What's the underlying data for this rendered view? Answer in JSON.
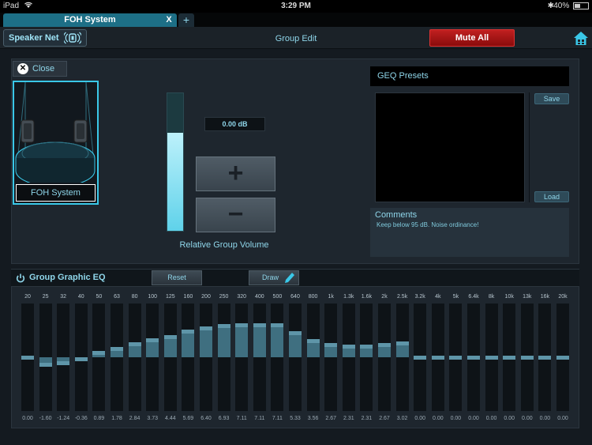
{
  "status_bar": {
    "device": "iPad",
    "time": "3:29 PM",
    "battery": "40%"
  },
  "tabs": {
    "active_label": "FOH System",
    "close_label": "X",
    "add_label": "+"
  },
  "toolbar": {
    "speaker_net_label": "Speaker Net",
    "title": "Group Edit",
    "mute_all_label": "Mute All"
  },
  "group": {
    "close_label": "Close",
    "name": "FOH System",
    "volume_value": "0.00 dB",
    "volume_level_fraction": 0.71,
    "plus_label": "+",
    "minus_label": "−",
    "volume_label": "Relative Group Volume"
  },
  "presets": {
    "title": "GEQ Presets",
    "save_label": "Save",
    "load_label": "Load",
    "comments_title": "Comments",
    "comments_text": "Keep below 95 dB. Noise ordinance!"
  },
  "eq": {
    "title": "Group Graphic EQ",
    "reset_label": "Reset",
    "draw_label": "Draw",
    "gain_range_db": 12,
    "bands": [
      {
        "freq": "20",
        "gain_label": "0.00",
        "gain": 0.0
      },
      {
        "freq": "25",
        "gain_label": "-1.60",
        "gain": -1.6
      },
      {
        "freq": "32",
        "gain_label": "-1.24",
        "gain": -1.24
      },
      {
        "freq": "40",
        "gain_label": "-0.36",
        "gain": -0.36
      },
      {
        "freq": "50",
        "gain_label": "0.89",
        "gain": 0.89
      },
      {
        "freq": "63",
        "gain_label": "1.78",
        "gain": 1.78
      },
      {
        "freq": "80",
        "gain_label": "2.84",
        "gain": 2.84
      },
      {
        "freq": "100",
        "gain_label": "3.73",
        "gain": 3.73
      },
      {
        "freq": "125",
        "gain_label": "4.44",
        "gain": 4.44
      },
      {
        "freq": "160",
        "gain_label": "5.69",
        "gain": 5.69
      },
      {
        "freq": "200",
        "gain_label": "6.40",
        "gain": 6.4
      },
      {
        "freq": "250",
        "gain_label": "6.93",
        "gain": 6.93
      },
      {
        "freq": "320",
        "gain_label": "7.11",
        "gain": 7.11
      },
      {
        "freq": "400",
        "gain_label": "7.11",
        "gain": 7.11
      },
      {
        "freq": "500",
        "gain_label": "7.11",
        "gain": 7.11
      },
      {
        "freq": "640",
        "gain_label": "5.33",
        "gain": 5.33
      },
      {
        "freq": "800",
        "gain_label": "3.56",
        "gain": 3.56
      },
      {
        "freq": "1k",
        "gain_label": "2.67",
        "gain": 2.67
      },
      {
        "freq": "1.3k",
        "gain_label": "2.31",
        "gain": 2.31
      },
      {
        "freq": "1.6k",
        "gain_label": "2.31",
        "gain": 2.31
      },
      {
        "freq": "2k",
        "gain_label": "2.67",
        "gain": 2.67
      },
      {
        "freq": "2.5k",
        "gain_label": "3.02",
        "gain": 3.02
      },
      {
        "freq": "3.2k",
        "gain_label": "0.00",
        "gain": 0.0
      },
      {
        "freq": "4k",
        "gain_label": "0.00",
        "gain": 0.0
      },
      {
        "freq": "5k",
        "gain_label": "0.00",
        "gain": 0.0
      },
      {
        "freq": "6.4k",
        "gain_label": "0.00",
        "gain": 0.0
      },
      {
        "freq": "8k",
        "gain_label": "0.00",
        "gain": 0.0
      },
      {
        "freq": "10k",
        "gain_label": "0.00",
        "gain": 0.0
      },
      {
        "freq": "13k",
        "gain_label": "0.00",
        "gain": 0.0
      },
      {
        "freq": "16k",
        "gain_label": "0.00",
        "gain": 0.0
      },
      {
        "freq": "20k",
        "gain_label": "0.00",
        "gain": 0.0
      }
    ]
  }
}
